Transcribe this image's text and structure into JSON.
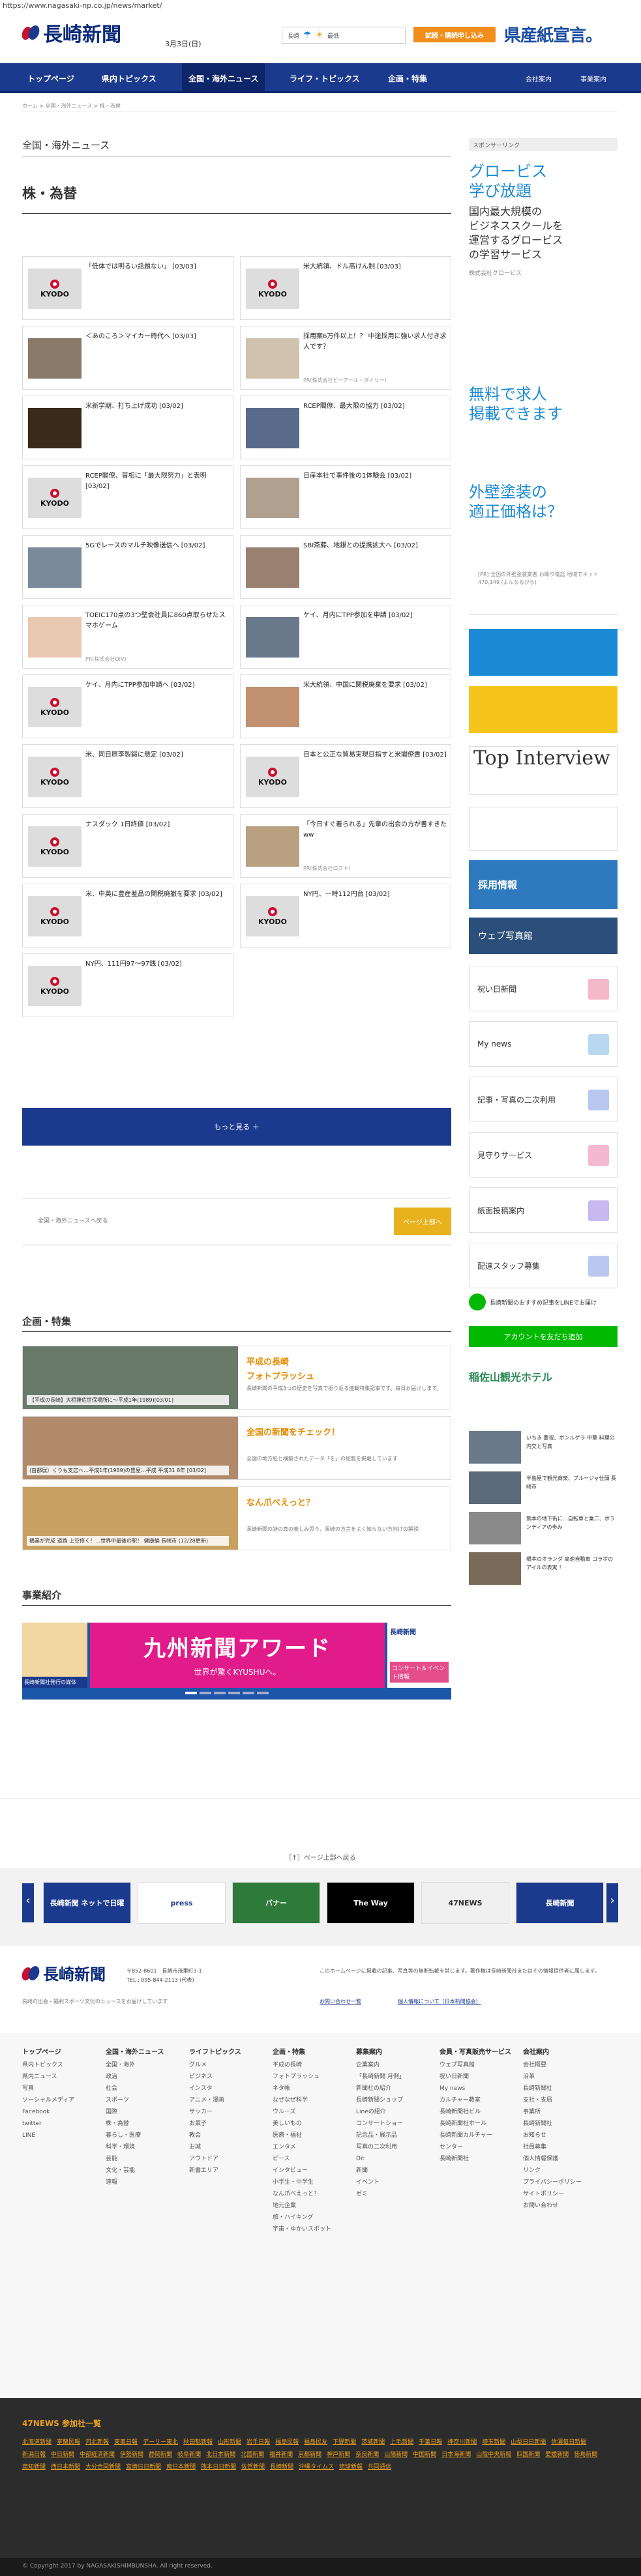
{
  "url": "https://www.nagasaki-np.co.jp/news/market/",
  "header": {
    "logo": "長崎新聞",
    "date": "3月3日(日)",
    "weather_city": "長崎",
    "weather_forecast": "最低",
    "subscribe_btn": "試読・購読申し込み",
    "pref_banner": "県産紙宣言。"
  },
  "nav": {
    "items": [
      "トップページ",
      "県内トピックス",
      "全国・海外ニュース",
      "ライフ・トピックス",
      "企画・特集"
    ],
    "right": [
      "会社案内",
      "事業案内"
    ]
  },
  "breadcrumb": "ホーム > 全国・海外ニュース > 株・為替",
  "section_label": "全国・海外ニュース",
  "section_title": "株・為替",
  "kyodo_label": "KYODO",
  "articles": [
    {
      "title": "「低体では明るい話題ない」 [03/03]",
      "src": ""
    },
    {
      "title": "米大統領、ドル高けん制 [03/03]",
      "src": ""
    },
    {
      "title": "＜あのころ＞マイカー時代へ [03/03]",
      "src": ""
    },
    {
      "title": "採用案6万件以上！？ 中途採用に強い求人付き求人です？",
      "src": "PR(株式会社ビーアール・ダイリー)"
    },
    {
      "title": "米新学期、打ち上げ成功 [03/02]",
      "src": ""
    },
    {
      "title": "RCEP閣僚、最大限の協力 [03/02]",
      "src": ""
    },
    {
      "title": "RCEP閣僚、首相に「最大限努力」と表明 [03/02]",
      "src": ""
    },
    {
      "title": "日産本社で事件後の1体験会 [03/02]",
      "src": ""
    },
    {
      "title": "5Gでレースのマルチ映像送信へ [03/02]",
      "src": ""
    },
    {
      "title": "SBI斎藤、地銀との提携拡大へ [03/02]",
      "src": ""
    },
    {
      "title": "TOEIC170点の3つ壁会社員に860点取らせたスマホゲーム",
      "src": "PR(株式会社DiV)"
    },
    {
      "title": "ケイ、月内にTPP参加を申請 [03/02]",
      "src": ""
    },
    {
      "title": "ケイ、月内にTPP参加申請へ [03/02]",
      "src": ""
    },
    {
      "title": "米大統領、中国に関税廃棄を要求 [03/02]",
      "src": ""
    },
    {
      "title": "米、同日原李製鍛に懸定 [03/02]",
      "src": ""
    },
    {
      "title": "日本と公正な貿易実現目指すと米閣僚書 [03/02]",
      "src": ""
    },
    {
      "title": "ナスダック 1日終値 [03/02]",
      "src": ""
    },
    {
      "title": "「今日すぐ着られる」先輩の出会の方が書すきたww",
      "src": "PR(株式会社ロフト)"
    },
    {
      "title": "米、中英に豊産羞品の関税廃撤を要求 [03/02]",
      "src": ""
    },
    {
      "title": "NY円、一時112円台 [03/02]",
      "src": ""
    },
    {
      "title": "NY円、111円97～97銭 [03/02]",
      "src": ""
    }
  ],
  "more_button": "もっと見る ＋",
  "back_link": "全国・海外ニュースへ戻る",
  "prev_button": "ページ上部へ",
  "features": {
    "heading": "企画・特集",
    "cards": [
      {
        "title": "平成の長崎\nフォトプラッシュ",
        "desc": "長崎新聞の平成3つの歴史を写真で振り返る連載特集記事です。毎日お届けします。",
        "caption": "【平成の長崎】大相撲佐世保場所に～平成1年(1989)[03/01]"
      },
      {
        "title": "全国の新聞をチェック！",
        "desc": "全国の地方紙と構築されたデータ「を」の総覧を掲載しています",
        "caption": "(首都展）くりも支店へ…平成1年(1989)の豊屋…平成 平成31 8年 [03/02]"
      },
      {
        "title": "なん爪べえっと？",
        "desc": "長崎新聞の謎の真の楽しみ思う、長崎の方言をよく知らない方向けの解説",
        "caption": "橋業が完成 道路 上空修く！…世界中最後の駅！ 健康編 長崎市 (12/28更新)"
      }
    ]
  },
  "business": {
    "heading": "事業紹介",
    "banner_title": "九州新聞アワード",
    "banner_sub": "世界が驚くKYUSHUへ。",
    "left_tag": "長崎新聞社発行の媒体",
    "right_tag": "コンサート＆イベント情報"
  },
  "sidebar": {
    "label": "スポンサーリンク",
    "ad1_title": "グロービス\n学び放題",
    "ad1_body": "国内最大規模の\nビジネススクールを\n運営するグロービス\nの学習サービス",
    "ad1_src": "株式会社グロービス",
    "ad2": "無料で求人\n掲載できます",
    "ad3": "外壁塗装の\n適正価格は？",
    "ad3_src": "[PR] 全国の外壁塗装業者 お断り電話 地域でネット470,149 (よんなるがち)",
    "recruit": "採用情報",
    "photo_shop": "ウェブ写真館",
    "links": [
      "祝い日新聞",
      "My news",
      "記事・写真の二次利用",
      "見守りサービス",
      "紙面投稿案内",
      "配達スタッフ募集"
    ],
    "line_btn": "アカウントを友だち追加",
    "hotel": "稲佐山観光ホテル",
    "side_news": [
      "いちき 慶祝、ボンルゲラ 中華 料理の内交と写真",
      "半島屋で観光商楽、ブルージャ仕頭 長崎市",
      "熊本の地下街に…自転車と乗二、ボランティアの歩み",
      "橋本のオランダ 高速自動車 コラボのアイルの表実 ！"
    ]
  },
  "page_top": "［↑］ページ上部へ戻る",
  "carousel": [
    "長崎新聞 ネットで日曜",
    "press",
    "バナー",
    "The Way",
    "47NEWS",
    "長崎新聞"
  ],
  "footer": {
    "address": "〒852-8601　長崎市茂里町3-1\nTEL : 095-844-2113 (代表)",
    "tagline": "長崎の出会・福利スポーツ文化のニュースをお届けしています",
    "notice": "このホームページに掲載の記事、写真等の無断転載を禁じます。著作権は長崎新聞社またはその情報提供者に属します。",
    "links_top": [
      "お問い合わせ一覧",
      "個人情報について（日本新聞協会）"
    ],
    "col1": [
      "トップページ",
      "県内トピックス",
      "県内ニュース",
      "写真",
      "ソーシャルメディア",
      "Facebook",
      "twitter",
      "LINE"
    ],
    "col2": [
      "全国・海外ニュース",
      "全国・海外",
      "政治",
      "社会",
      "スポーツ",
      "国際",
      "株・為替",
      "暮らし・医療",
      "科学・環境",
      "芸能",
      "文化・芸能",
      "速報"
    ],
    "col3": [
      "ライフトピックス",
      "グルメ",
      "ビジネス",
      "インスタ",
      "アニメ・漫画",
      "サッカー",
      "お菓子",
      "教会",
      "お城",
      "アウトドア",
      "新書エリア"
    ],
    "col4": [
      "企画・特集",
      "平成の長崎",
      "フォトプラッシュ",
      "ネタ帳",
      "なぜなぜ科学",
      "ウルーズ",
      "美しいもの",
      "医療・福祉",
      "エンタメ",
      "ピース",
      "インタビュー",
      "小学生・中学生",
      "なん爪べえっと？",
      "地元企業",
      "旅・ハイキング",
      "宇宙・ゆかいスポット"
    ],
    "col5": [
      "募集案内",
      "企業案内",
      "「長崎新聞 月例」",
      "新聞社の紹介",
      "長崎新聞ショップ",
      "Lineの紹介",
      "コンサートショー",
      "記念品・展示品",
      "写真の二次利用",
      "Dit",
      "新聞",
      "イベント",
      "ゼミ"
    ],
    "col6": [
      "会員・写真販売サービス",
      "ウェブ写真館",
      "祝い日新聞",
      "My news",
      "カルチャー教室",
      "長崎新聞社ビル",
      "長崎新聞社ホール",
      "長崎新聞カルチャー",
      "センター",
      "長崎新聞社"
    ],
    "col7": [
      "会社案内",
      "会社概要",
      "沿革",
      "長崎新聞社",
      "支社・支局",
      "事業所",
      "長崎新聞社",
      "お知らせ",
      "社員募集",
      "個人情報保護",
      "リンク",
      "プライバシーポリシー",
      "サイトポリシー",
      "お問い合わせ"
    ]
  },
  "footer_47": {
    "heading": "47NEWS 参加社一覧",
    "members": [
      "北海道新聞",
      "室蘭民報",
      "河北新報",
      "東奥日報",
      "デーリー東北",
      "秋田魁新報",
      "山形新聞",
      "岩手日報",
      "福島民報",
      "福島民友",
      "下野新聞",
      "茨城新聞",
      "上毛新聞",
      "千葉日報",
      "神奈川新聞",
      "埼玉新聞",
      "山梨日日新聞",
      "信濃毎日新聞",
      "新潟日報",
      "中日新聞",
      "中部経済新聞",
      "伊勢新聞",
      "静岡新聞",
      "岐阜新聞",
      "北日本新聞",
      "北國新聞",
      "福井新聞",
      "京都新聞",
      "神戸新聞",
      "奈良新聞",
      "山陽新聞",
      "中国新聞",
      "日本海新聞",
      "山陰中央新報",
      "四国新聞",
      "愛媛新聞",
      "徳島新聞",
      "高知新聞",
      "西日本新聞",
      "大分合同新聞",
      "宮崎日日新聞",
      "南日本新聞",
      "熊本日日新聞",
      "佐賀新聞",
      "長崎新聞",
      "沖縄タイムス",
      "琉球新報",
      "共同通信"
    ]
  },
  "copyright": "© Copyright 2017 by NAGASAKISHIMBUNSHA. All right reserved.",
  "colors": {
    "navy": "#1b3a8e",
    "orange": "#f18e1c",
    "gold": "#e8b21c",
    "red": "#c8102e"
  }
}
